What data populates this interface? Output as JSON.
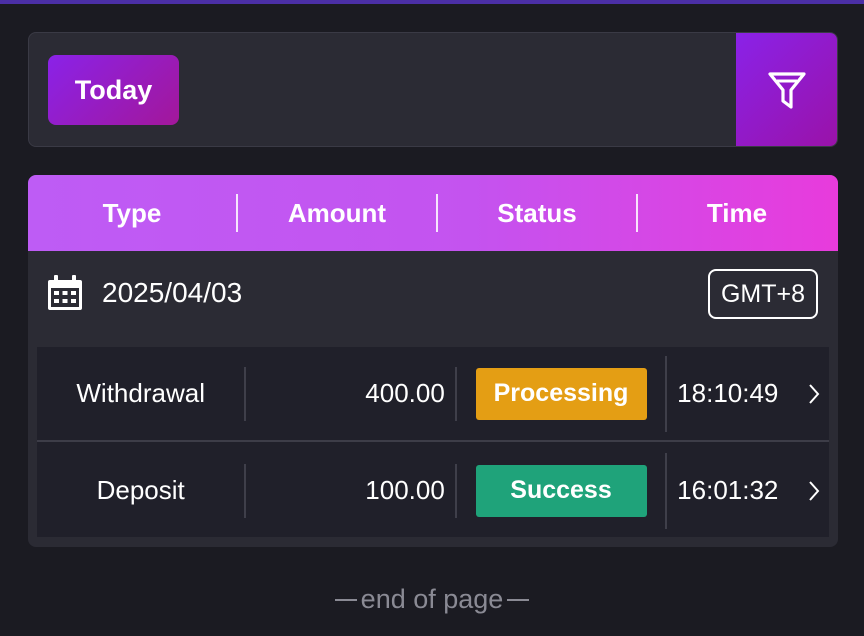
{
  "filter": {
    "today_label": "Today",
    "filter_icon": "funnel-icon"
  },
  "table": {
    "headers": [
      "Type",
      "Amount",
      "Status",
      "Time"
    ],
    "date_group": {
      "date": "2025/04/03",
      "timezone": "GMT+8",
      "icon": "calendar-icon"
    },
    "rows": [
      {
        "type": "Withdrawal",
        "amount": "400.00",
        "status": "Processing",
        "status_color": "#e49e14",
        "time": "18:10:49"
      },
      {
        "type": "Deposit",
        "amount": "100.00",
        "status": "Success",
        "status_color": "#1fa37a",
        "time": "16:01:32"
      }
    ]
  },
  "footer": {
    "end_text": "end of page"
  },
  "colors": {
    "background": "#1b1b22",
    "card": "#2b2b34",
    "accent_purple": "#8a22e8",
    "header_gradient_start": "#be5cf5",
    "header_gradient_end": "#e83bdc"
  }
}
